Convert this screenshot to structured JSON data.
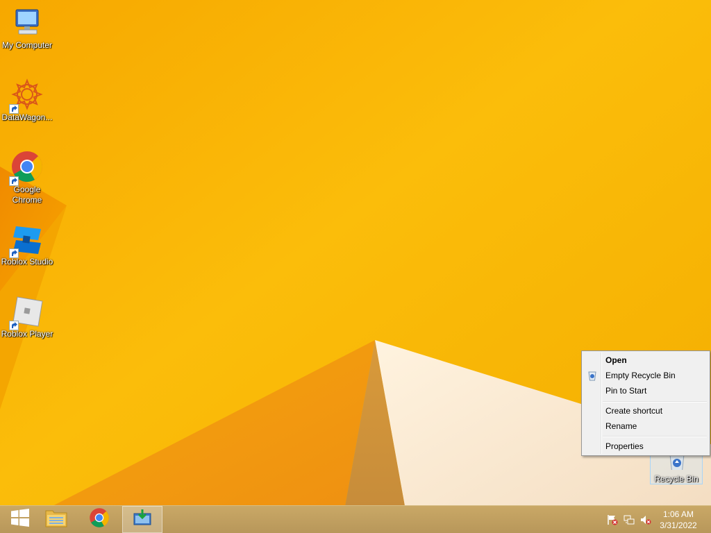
{
  "desktop": {
    "icons": [
      {
        "label": "My Computer",
        "icon": "computer-icon"
      },
      {
        "label": "DataWagon...",
        "icon": "datawagon-icon",
        "shortcut": true
      },
      {
        "label": "Google Chrome",
        "icon": "chrome-icon",
        "shortcut": true
      },
      {
        "label": "Roblox Studio",
        "icon": "roblox-studio-icon",
        "shortcut": true
      },
      {
        "label": "Roblox Player",
        "icon": "roblox-player-icon",
        "shortcut": true
      },
      {
        "label": "Recycle Bin",
        "icon": "recycle-bin-icon",
        "selected": true
      }
    ]
  },
  "context_menu": {
    "items": [
      {
        "label": "Open",
        "bold": true
      },
      {
        "label": "Empty Recycle Bin",
        "icon": "recycle-bin-small-icon"
      },
      {
        "label": "Pin to Start"
      },
      {
        "label": "Create shortcut"
      },
      {
        "label": "Rename"
      },
      {
        "label": "Properties"
      }
    ]
  },
  "taskbar": {
    "buttons": [
      {
        "name": "start",
        "icon": "windows-logo-icon"
      },
      {
        "name": "file-explorer",
        "icon": "folder-icon"
      },
      {
        "name": "chrome",
        "icon": "chrome-icon"
      },
      {
        "name": "app",
        "icon": "download-window-icon",
        "active": true
      }
    ],
    "tray": [
      {
        "icon": "action-center-flag-icon"
      },
      {
        "icon": "network-icon"
      },
      {
        "icon": "volume-muted-icon"
      }
    ],
    "clock": {
      "time": "1:06 AM",
      "date": "3/31/2022"
    }
  },
  "colors": {
    "wallpaper": "#f9b300",
    "wallpaper_dark": "#ef8e00",
    "accent_white": "#fbe8c8"
  }
}
